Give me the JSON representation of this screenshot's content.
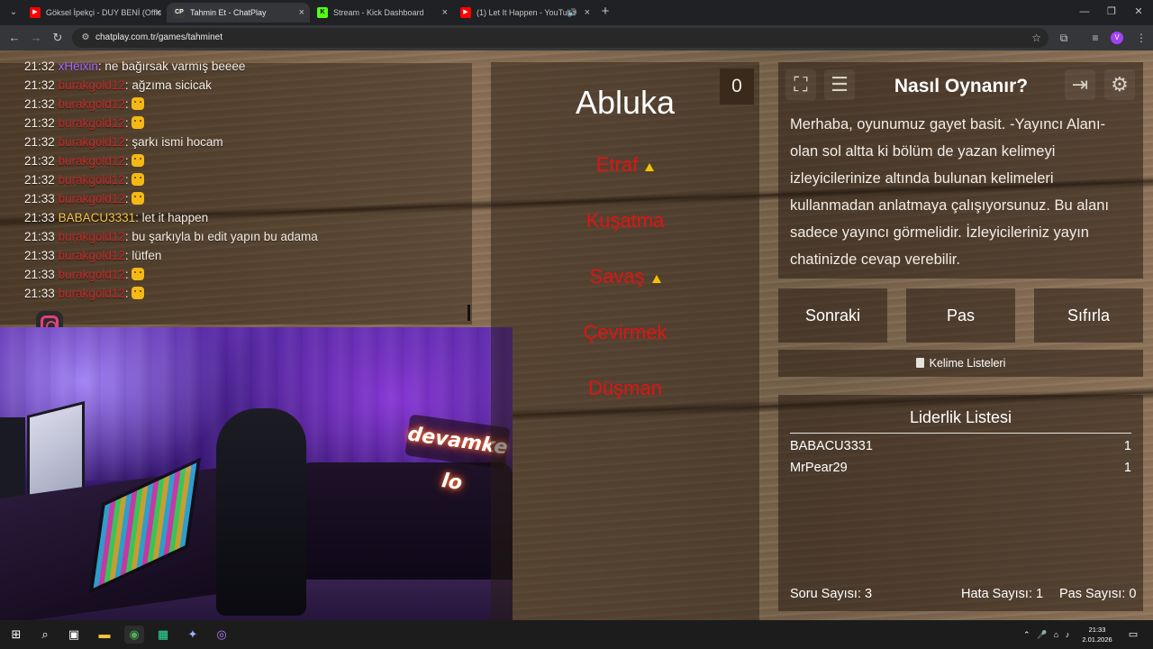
{
  "browser": {
    "tabs": [
      {
        "title": "Göksel İpekçi - DUY BENİ (Offic",
        "favicon": "youtube-icon",
        "color": "#ff0000",
        "active": false
      },
      {
        "title": "Tahmin Et - ChatPlay",
        "favicon": "CP",
        "color": "#3b3b3b",
        "active": true
      },
      {
        "title": "Stream - Kick Dashboard",
        "favicon": "K",
        "color": "#53fc18",
        "active": false
      },
      {
        "title": "(1) Let It Happen - YouTube",
        "favicon": "youtube-icon",
        "color": "#ff0000",
        "active": false
      }
    ],
    "url": "chatplay.com.tr/games/tahminet",
    "profile_initial": "V"
  },
  "chat": {
    "messages": [
      {
        "time": "21:32",
        "user": "xHeixin",
        "user_style": "purple",
        "text": ": ne bağırsak varmış beeee",
        "emoji": false
      },
      {
        "time": "21:32",
        "user": "burakgold12",
        "user_style": "red",
        "text": ": ağzıma sicicak",
        "emoji": false
      },
      {
        "time": "21:32",
        "user": "burakgold12",
        "user_style": "red",
        "text": ": ",
        "emoji": true
      },
      {
        "time": "21:32",
        "user": "burakgold12",
        "user_style": "red",
        "text": ": ",
        "emoji": true
      },
      {
        "time": "21:32",
        "user": "burakgold12",
        "user_style": "red",
        "text": ": şarkı ismi hocam",
        "emoji": false
      },
      {
        "time": "21:32",
        "user": "burakgold12",
        "user_style": "red",
        "text": ": ",
        "emoji": true
      },
      {
        "time": "21:32",
        "user": "burakgold12",
        "user_style": "red",
        "text": ": ",
        "emoji": true
      },
      {
        "time": "21:33",
        "user": "burakgold12",
        "user_style": "red",
        "text": ": ",
        "emoji": true
      },
      {
        "time": "21:33",
        "user": "BABACU3331",
        "user_style": "gold",
        "text": ": let it happen",
        "emoji": false
      },
      {
        "time": "21:33",
        "user": "burakgold12",
        "user_style": "red",
        "text": ": bu şarkıyla bı edit yapın bu adama",
        "emoji": false
      },
      {
        "time": "21:33",
        "user": "burakgold12",
        "user_style": "red",
        "text": ": lütfen",
        "emoji": false
      },
      {
        "time": "21:33",
        "user": "burakgold12",
        "user_style": "red",
        "text": ": ",
        "emoji": true
      },
      {
        "time": "21:33",
        "user": "burakgold12",
        "user_style": "red",
        "text": ": ",
        "emoji": true
      }
    ]
  },
  "webcam": {
    "sign_text": "devamke lo"
  },
  "game": {
    "score": "0",
    "word": "Abluka",
    "taboo_words": [
      {
        "text": "Etraf",
        "warning": true
      },
      {
        "text": "Kuşatma",
        "warning": false
      },
      {
        "text": "Savaş",
        "warning": true
      },
      {
        "text": "Çevirmek",
        "warning": false
      },
      {
        "text": "Düşman",
        "warning": false
      }
    ]
  },
  "howto": {
    "title": "Nasıl Oynanır?",
    "text": "Merhaba, oyunumuz gayet basit. -Yayıncı Alanı- olan sol altta ki bölüm de yazan kelimeyi izleyicilerinize altında bulunan kelimeleri kullanmadan anlatmaya çalışıyorsunuz. Bu alanı sadece yayıncı görmelidir. İzleyicileriniz yayın chatinizde cevap verebilir."
  },
  "actions": {
    "next": "Sonraki",
    "pass": "Pas",
    "reset": "Sıfırla",
    "word_lists": "Kelime Listeleri"
  },
  "leaderboard": {
    "title": "Liderlik Listesi",
    "rows": [
      {
        "name": "BABACU3331",
        "score": "1"
      },
      {
        "name": "MrPear29",
        "score": "1"
      }
    ],
    "question_count": "Soru Sayısı: 3",
    "error_count": "Hata Sayısı: 1",
    "pass_count": "Pas Sayısı: 0"
  },
  "taskbar": {
    "time": "21:33",
    "date": "2.01.2026"
  }
}
